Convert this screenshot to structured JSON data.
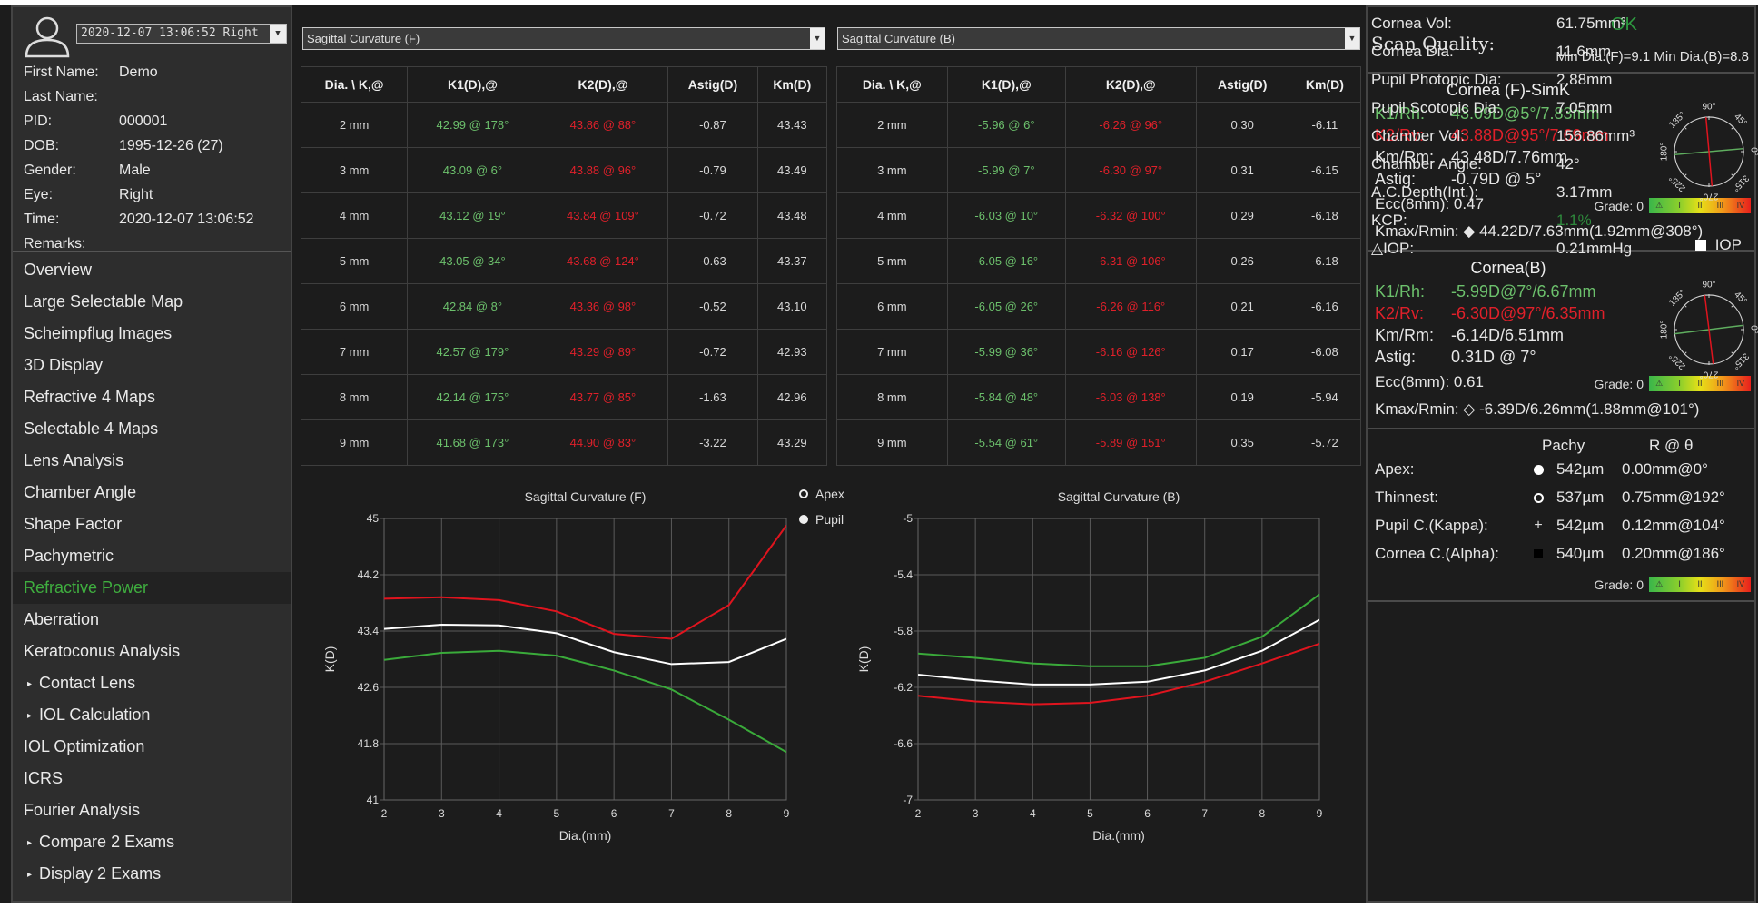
{
  "patient": {
    "exam_selector": "2020-12-07 13:06:52 Right",
    "fields": [
      {
        "label": "First Name:",
        "value": "Demo"
      },
      {
        "label": "Last Name:",
        "value": ""
      },
      {
        "label": "PID:",
        "value": "000001"
      },
      {
        "label": "DOB:",
        "value": "1995-12-26  (27)"
      },
      {
        "label": "Gender:",
        "value": "Male"
      },
      {
        "label": "Eye:",
        "value": "Right"
      },
      {
        "label": "Time:",
        "value": "2020-12-07 13:06:52"
      },
      {
        "label": "Remarks:",
        "value": ""
      }
    ]
  },
  "nav": {
    "active": "Refractive Power",
    "items": [
      {
        "label": "Overview",
        "expandable": false
      },
      {
        "label": "Large Selectable Map",
        "expandable": false
      },
      {
        "label": "Scheimpflug Images",
        "expandable": false
      },
      {
        "label": "3D Display",
        "expandable": false
      },
      {
        "label": "Refractive 4 Maps",
        "expandable": false
      },
      {
        "label": "Selectable 4 Maps",
        "expandable": false
      },
      {
        "label": "Lens Analysis",
        "expandable": false
      },
      {
        "label": "Chamber Angle",
        "expandable": false
      },
      {
        "label": "Shape Factor",
        "expandable": false
      },
      {
        "label": "Pachymetric",
        "expandable": false
      },
      {
        "label": "Refractive Power",
        "expandable": false
      },
      {
        "label": "Aberration",
        "expandable": false
      },
      {
        "label": "Keratoconus Analysis",
        "expandable": false
      },
      {
        "label": "Contact Lens",
        "expandable": true
      },
      {
        "label": "IOL Calculation",
        "expandable": true
      },
      {
        "label": "IOL Optimization",
        "expandable": false
      },
      {
        "label": "ICRS",
        "expandable": false
      },
      {
        "label": "Fourier Analysis",
        "expandable": false
      },
      {
        "label": "Compare 2 Exams",
        "expandable": true
      },
      {
        "label": "Display 2 Exams",
        "expandable": true
      }
    ]
  },
  "tables": [
    {
      "selector": "Sagittal Curvature (F)",
      "headers": [
        "Dia. \\ K,@",
        "K1(D),@",
        "K2(D),@",
        "Astig(D)",
        "Km(D)"
      ],
      "rows": [
        [
          "2 mm",
          "42.99 @ 178°",
          "43.86 @ 88°",
          "-0.87",
          "43.43"
        ],
        [
          "3 mm",
          "43.09 @ 6°",
          "43.88 @ 96°",
          "-0.79",
          "43.49"
        ],
        [
          "4 mm",
          "43.12 @ 19°",
          "43.84 @ 109°",
          "-0.72",
          "43.48"
        ],
        [
          "5 mm",
          "43.05 @ 34°",
          "43.68 @ 124°",
          "-0.63",
          "43.37"
        ],
        [
          "6 mm",
          "42.84 @ 8°",
          "43.36 @ 98°",
          "-0.52",
          "43.10"
        ],
        [
          "7 mm",
          "42.57 @ 179°",
          "43.29 @ 89°",
          "-0.72",
          "42.93"
        ],
        [
          "8 mm",
          "42.14 @ 175°",
          "43.77 @ 85°",
          "-1.63",
          "42.96"
        ],
        [
          "9 mm",
          "41.68 @ 173°",
          "44.90 @ 83°",
          "-3.22",
          "43.29"
        ]
      ]
    },
    {
      "selector": "Sagittal Curvature (B)",
      "headers": [
        "Dia. \\ K,@",
        "K1(D),@",
        "K2(D),@",
        "Astig(D)",
        "Km(D)"
      ],
      "rows": [
        [
          "2 mm",
          "-5.96 @ 6°",
          "-6.26 @ 96°",
          "0.30",
          "-6.11"
        ],
        [
          "3 mm",
          "-5.99 @ 7°",
          "-6.30 @ 97°",
          "0.31",
          "-6.15"
        ],
        [
          "4 mm",
          "-6.03 @ 10°",
          "-6.32 @ 100°",
          "0.29",
          "-6.18"
        ],
        [
          "5 mm",
          "-6.05 @ 16°",
          "-6.31 @ 106°",
          "0.26",
          "-6.18"
        ],
        [
          "6 mm",
          "-6.05 @ 26°",
          "-6.26 @ 116°",
          "0.21",
          "-6.16"
        ],
        [
          "7 mm",
          "-5.99 @ 36°",
          "-6.16 @ 126°",
          "0.17",
          "-6.08"
        ],
        [
          "8 mm",
          "-5.84 @ 48°",
          "-6.03 @ 138°",
          "0.19",
          "-5.94"
        ],
        [
          "9 mm",
          "-5.54 @ 61°",
          "-5.89 @ 151°",
          "0.35",
          "-5.72"
        ]
      ]
    }
  ],
  "legend": {
    "items": [
      {
        "label": "Apex",
        "marker": "open-circle"
      },
      {
        "label": "Pupil",
        "marker": "filled-circle"
      }
    ]
  },
  "chart_data": [
    {
      "type": "line",
      "title": "Sagittal Curvature (F)",
      "xlabel": "Dia.(mm)",
      "ylabel": "K(D)",
      "x": [
        2,
        3,
        4,
        5,
        6,
        7,
        8,
        9
      ],
      "xlim": [
        2,
        9
      ],
      "ylim": [
        41,
        45
      ],
      "yticks": [
        45,
        44.2,
        43.4,
        42.6,
        41.8,
        41
      ],
      "ytick_labels": [
        "45",
        "44.2",
        "43.4",
        "42.6",
        "41.8",
        "41"
      ],
      "xticks": [
        "2",
        "3",
        "4",
        "5",
        "6",
        "7",
        "8",
        "9"
      ],
      "grid": true,
      "series": [
        {
          "name": "K2",
          "color": "#e0141e",
          "values": [
            43.86,
            43.88,
            43.84,
            43.68,
            43.36,
            43.29,
            43.77,
            44.9
          ]
        },
        {
          "name": "Km",
          "color": "#ffffff",
          "values": [
            43.43,
            43.49,
            43.48,
            43.37,
            43.1,
            42.93,
            42.96,
            43.29
          ]
        },
        {
          "name": "K1",
          "color": "#3aaa3a",
          "values": [
            42.99,
            43.09,
            43.12,
            43.05,
            42.84,
            42.57,
            42.14,
            41.68
          ]
        }
      ]
    },
    {
      "type": "line",
      "title": "Sagittal Curvature (B)",
      "xlabel": "Dia.(mm)",
      "ylabel": "K(D)",
      "x": [
        2,
        3,
        4,
        5,
        6,
        7,
        8,
        9
      ],
      "xlim": [
        2,
        9
      ],
      "ylim": [
        -7,
        -5
      ],
      "yticks": [
        -5,
        -5.4,
        -5.8,
        -6.2,
        -6.6,
        -7
      ],
      "ytick_labels": [
        "-5",
        "-5.4",
        "-5.8",
        "-6.2",
        "-6.6",
        "-7"
      ],
      "xticks": [
        "2",
        "3",
        "4",
        "5",
        "6",
        "7",
        "8",
        "9"
      ],
      "grid": true,
      "series": [
        {
          "name": "K1",
          "color": "#3aaa3a",
          "values": [
            -5.96,
            -5.99,
            -6.03,
            -6.05,
            -6.05,
            -5.99,
            -5.84,
            -5.54
          ]
        },
        {
          "name": "Km",
          "color": "#ffffff",
          "values": [
            -6.11,
            -6.15,
            -6.18,
            -6.18,
            -6.16,
            -6.08,
            -5.94,
            -5.72
          ]
        },
        {
          "name": "K2",
          "color": "#e0141e",
          "values": [
            -6.26,
            -6.3,
            -6.32,
            -6.31,
            -6.26,
            -6.16,
            -6.03,
            -5.89
          ]
        }
      ]
    }
  ],
  "scan_quality": {
    "label": "Scan Quality:",
    "status": "OK",
    "min_dia": "Min Dia.(F)=9.1  Min Dia.(B)=8.8"
  },
  "cornea_front": {
    "title": "Cornea (F)-SimK",
    "k1": {
      "label": "K1/Rh:",
      "value": "43.09D@5°/7.83mm"
    },
    "k2": {
      "label": "K2/Rv:",
      "value": "43.88D@95°/7.69mm"
    },
    "km": {
      "label": "Km/Rm:",
      "value": "43.48D/7.76mm"
    },
    "astig": {
      "label": "Astig:",
      "value": "-0.79D @ 5°"
    },
    "ecc": "Ecc(8mm):  0.47",
    "grade": "Grade: 0",
    "kmax": "Kmax/Rmin: ◆ 44.22D/7.63mm(1.92mm@308°)",
    "k1_axis_deg": 5,
    "k2_axis_deg": 95
  },
  "cornea_back": {
    "title": "Cornea(B)",
    "k1": {
      "label": "K1/Rh:",
      "value": "-5.99D@7°/6.67mm"
    },
    "k2": {
      "label": "K2/Rv:",
      "value": "-6.30D@97°/6.35mm"
    },
    "km": {
      "label": "Km/Rm:",
      "value": "-6.14D/6.51mm"
    },
    "astig": {
      "label": "Astig:",
      "value": "0.31D @ 7°"
    },
    "ecc": "Ecc(8mm):  0.61",
    "grade": "Grade: 0",
    "kmax": "Kmax/Rmin: ◇ -6.39D/6.26mm(1.88mm@101°)",
    "k1_axis_deg": 7,
    "k2_axis_deg": 97
  },
  "compass_labels": [
    "90°",
    "45°",
    "0°",
    "315°",
    "270°",
    "225°",
    "180°",
    "135°"
  ],
  "grade_bar": [
    "⚠",
    "I",
    "II",
    "III",
    "IV"
  ],
  "pachy": {
    "col_pachy": "Pachy",
    "col_r": "R @ θ",
    "rows": [
      {
        "label": "Apex:",
        "symbol": "filled-dot",
        "pachy": "542µm",
        "r": "0.00mm@0°"
      },
      {
        "label": "Thinnest:",
        "symbol": "open-circle",
        "pachy": "537µm",
        "r": "0.75mm@192°"
      },
      {
        "label": "Pupil C.(Kappa):",
        "symbol": "crosshair",
        "pachy": "542µm",
        "r": "0.12mm@104°"
      },
      {
        "label": "Cornea C.(Alpha):",
        "symbol": "black-square",
        "pachy": "540µm",
        "r": "0.20mm@186°"
      }
    ],
    "grade": "Grade: 0"
  },
  "metrics": [
    {
      "label": "Cornea Vol:",
      "value": "61.75mm³"
    },
    {
      "label": "Cornea Dia:",
      "value": "11.6mm"
    },
    {
      "label": "Pupil Photopic Dia:",
      "value": "2.88mm"
    },
    {
      "label": "Pupil Scotopic Dia:",
      "value": "7.05mm"
    },
    {
      "label": "Chamber Vol:",
      "value": "156.86mm³"
    },
    {
      "label": "Chamber Angle:",
      "value": "42°"
    },
    {
      "label": "A.C.Depth(Int.):",
      "value": "3.17mm"
    },
    {
      "label": "KCP:",
      "value": "1.1%",
      "color": "#2e8a3c"
    },
    {
      "label": "△IOP:",
      "value": "0.21mmHg"
    }
  ],
  "iop_checkbox": {
    "label": "IOP",
    "checked": false
  }
}
